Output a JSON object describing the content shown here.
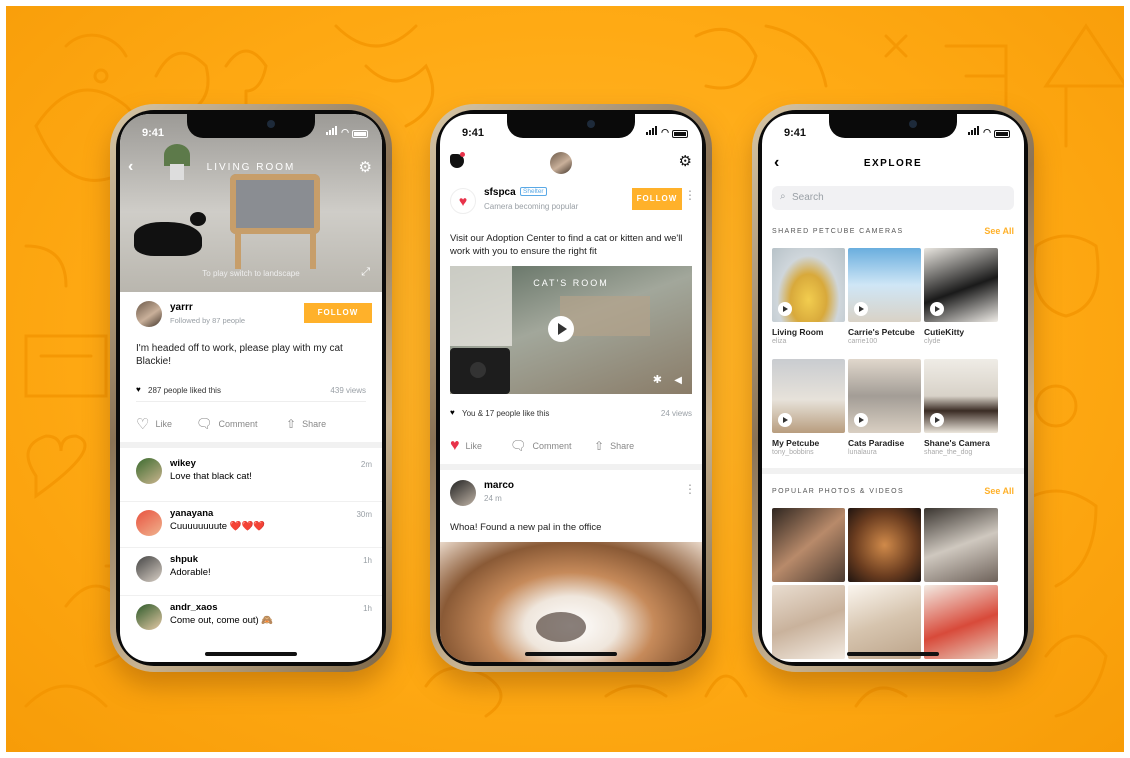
{
  "colors": {
    "accent": "#ffb12a",
    "background": "#ffaa14",
    "like": "#e8324a"
  },
  "phone1": {
    "time": "9:41",
    "room_title": "LIVING ROOM",
    "landscape_hint": "To play switch to landscape",
    "author": "yarrr",
    "followers": "Followed by 87 people",
    "follow_label": "FOLLOW",
    "post_text": "I'm headed off to work, please play with my cat Blackie!",
    "likes": "287 people liked this",
    "views": "439 views",
    "actions": {
      "like": "Like",
      "comment": "Comment",
      "share": "Share"
    },
    "comments": [
      {
        "user": "wikey",
        "text": "Love that black cat!",
        "time": "2m"
      },
      {
        "user": "yanayana",
        "text": "Cuuuuuuuute ❤️❤️❤️",
        "time": "30m"
      },
      {
        "user": "shpuk",
        "text": "Adorable!",
        "time": "1h"
      },
      {
        "user": "andr_xaos",
        "text": "Come out, come out) 🙈",
        "time": "1h"
      }
    ]
  },
  "phone2": {
    "time": "9:41",
    "author": "sfspca",
    "badge": "Shelter",
    "subtitle": "Camera becoming popular",
    "follow_label": "FOLLOW",
    "post_text": "Visit our Adoption Center to find a cat or kitten and we'll work with you to ensure the right fit",
    "video_title": "CAT'S ROOM",
    "likes": "You & 17 people like this",
    "views": "24 views",
    "actions": {
      "like": "Like",
      "comment": "Comment",
      "share": "Share"
    },
    "post2_author": "marco",
    "post2_time": "24 m",
    "post2_text": "Whoa! Found a new pal in the office"
  },
  "phone3": {
    "time": "9:41",
    "title": "EXPLORE",
    "search_placeholder": "Search",
    "section1": "SHARED PETCUBE CAMERAS",
    "section2": "POPULAR PHOTOS & VIDEOS",
    "see_all": "See All",
    "cameras": [
      {
        "name": "Living Room",
        "user": "eliza"
      },
      {
        "name": "Carrie's Petcube",
        "user": "carrie100"
      },
      {
        "name": "CutieKitty",
        "user": "clyde"
      },
      {
        "name": "My Petcube",
        "user": "tony_bobbins"
      },
      {
        "name": "Cats Paradise",
        "user": "lunalaura"
      },
      {
        "name": "Shane's Camera",
        "user": "shane_the_dog"
      }
    ]
  }
}
